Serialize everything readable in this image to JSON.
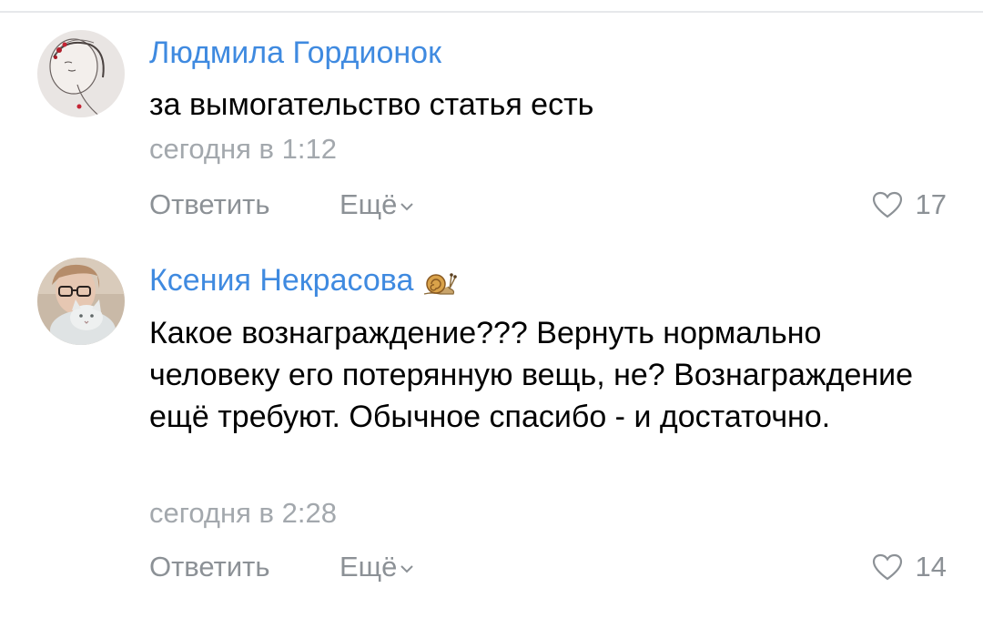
{
  "comments": [
    {
      "author": "Людмила Гордионок",
      "text": "за вымогательство статья есть",
      "time": "сегодня в 1:12",
      "reply_label": "Ответить",
      "more_label": "Ещё",
      "likes": "17",
      "avatar": "avatar-drawn-woman"
    },
    {
      "author": "Ксения Некрасова",
      "author_emoji": "snail-icon",
      "text": "Какое вознаграждение??? Вернуть нормально человеку его потерянную вещь, не? Вознаграждение ещё требуют. Обычное спасибо - и достаточно.",
      "time": "сегодня в 2:28",
      "reply_label": "Ответить",
      "more_label": "Ещё",
      "likes": "14",
      "avatar": "avatar-woman-with-cat"
    }
  ],
  "colors": {
    "author": "#3f8ae0",
    "text": "#000000",
    "meta": "#a3a8ad",
    "actions": "#8c9196"
  }
}
